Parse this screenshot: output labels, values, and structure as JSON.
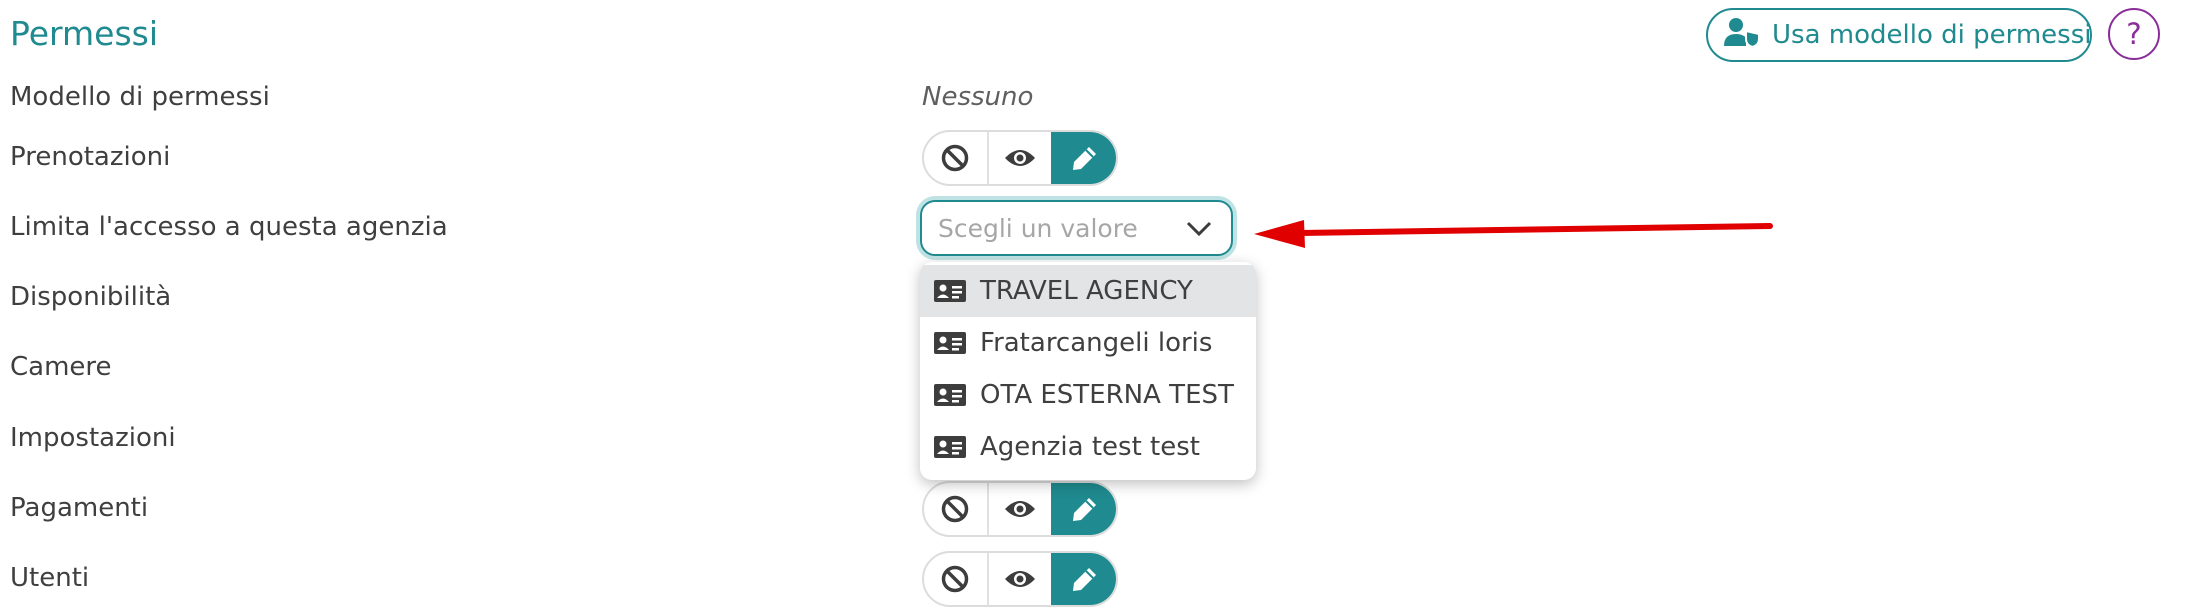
{
  "section": {
    "title": "Permessi"
  },
  "header_actions": {
    "use_model_label": "Usa modello di permessi",
    "help_label": "?"
  },
  "rows": {
    "model": {
      "label": "Modello di permessi",
      "value": "Nessuno"
    },
    "bookings": {
      "label": "Prenotazioni",
      "selected": "edit"
    },
    "limit_access": {
      "label": "Limita l'accesso a questa agenzia",
      "placeholder": "Scegli un valore"
    },
    "availability": {
      "label": "Disponibilità"
    },
    "rooms": {
      "label": "Camere"
    },
    "settings": {
      "label": "Impostazioni"
    },
    "payments": {
      "label": "Pagamenti",
      "selected": "edit"
    },
    "users": {
      "label": "Utenti",
      "selected": "edit"
    }
  },
  "dropdown_options": [
    {
      "label": "TRAVEL AGENCY",
      "highlighted": true
    },
    {
      "label": "Fratarcangeli loris",
      "highlighted": false
    },
    {
      "label": "OTA ESTERNA TEST",
      "highlighted": false
    },
    {
      "label": "Agenzia test test",
      "highlighted": false
    }
  ],
  "colors": {
    "accent": "#1f8a8f",
    "help": "#8a2d9a",
    "annotation_arrow": "#e00000"
  }
}
